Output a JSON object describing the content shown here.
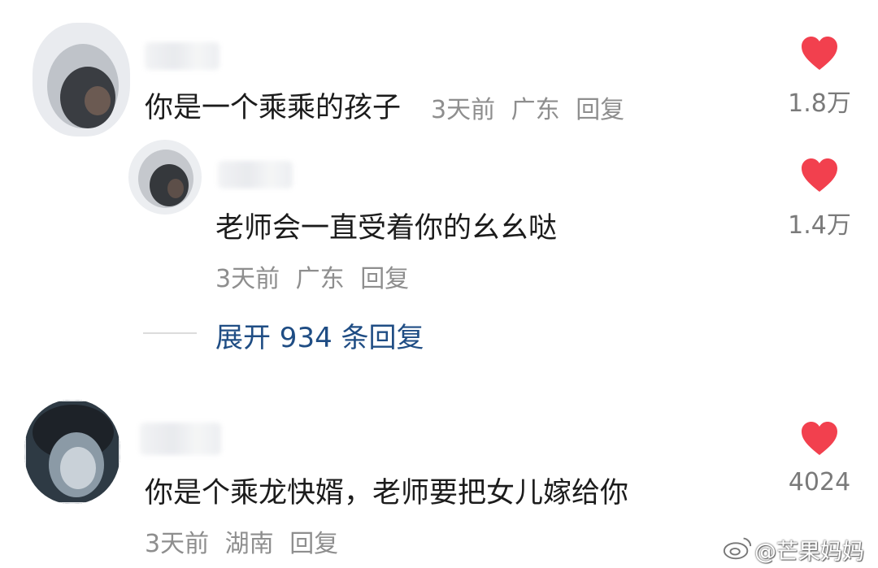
{
  "comments": [
    {
      "text": "你是一个乘乘的孩子",
      "time": "3天前",
      "location": "广东",
      "reply_label": "回复",
      "likes": "1.8万"
    },
    {
      "text": "老师会一直受着你的幺幺哒",
      "time": "3天前",
      "location": "广东",
      "reply_label": "回复",
      "likes": "1.4万"
    },
    {
      "text": "你是个乘龙快婿，老师要把女儿嫁给你",
      "time": "3天前",
      "location": "湖南",
      "reply_label": "回复",
      "likes": "4024"
    }
  ],
  "expand_replies": "展开 934 条回复",
  "watermark": "@芒果妈妈",
  "colors": {
    "heart": "#f2404e",
    "link": "#1f4d84",
    "meta": "#8e8e8e"
  }
}
